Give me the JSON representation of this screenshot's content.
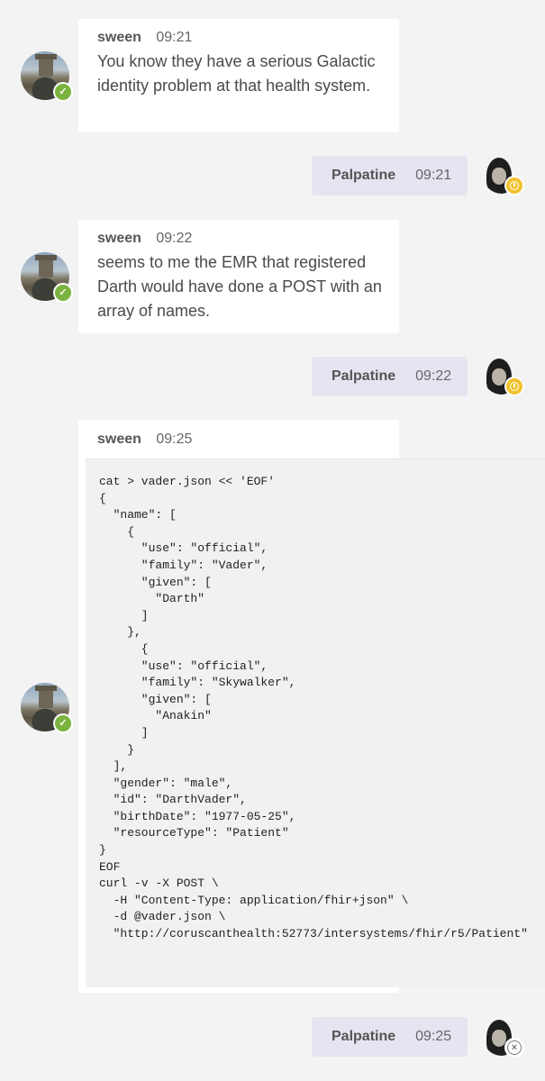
{
  "messages": [
    {
      "author": "sween",
      "time": "09:21",
      "text": "You know they have a serious Galactic identity problem at that health system."
    },
    {
      "author": "Palpatine",
      "time": "09:21"
    },
    {
      "author": "sween",
      "time": "09:22",
      "text": "seems to me the EMR that registered Darth would have done a POST with an array of names."
    },
    {
      "author": "Palpatine",
      "time": "09:22"
    },
    {
      "author": "sween",
      "time": "09:25",
      "code": "cat > vader.json << 'EOF'\n{\n  \"name\": [\n    {\n      \"use\": \"official\",\n      \"family\": \"Vader\",\n      \"given\": [\n        \"Darth\"\n      ]\n    },\n      {\n      \"use\": \"official\",\n      \"family\": \"Skywalker\",\n      \"given\": [\n        \"Anakin\"\n      ]\n    }\n  ],\n  \"gender\": \"male\",\n  \"id\": \"DarthVader\",\n  \"birthDate\": \"1977-05-25\",\n  \"resourceType\": \"Patient\"\n}\nEOF\ncurl -v -X POST \\\n  -H \"Content-Type: application/fhir+json\" \\\n  -d @vader.json \\\n  \"http://coruscanthealth:52773/intersystems/fhir/r5/Patient\""
    },
    {
      "author": "Palpatine",
      "time": "09:25"
    }
  ],
  "presence": {
    "sween": "available",
    "palpatine_1": "away",
    "palpatine_2": "away",
    "palpatine_3": "offline"
  },
  "colors": {
    "background": "#f3f3f3",
    "incoming_bubble": "#ffffff",
    "outgoing_bubble": "#e5e5f1",
    "available": "#7ab33e",
    "away": "#f2c22e"
  }
}
